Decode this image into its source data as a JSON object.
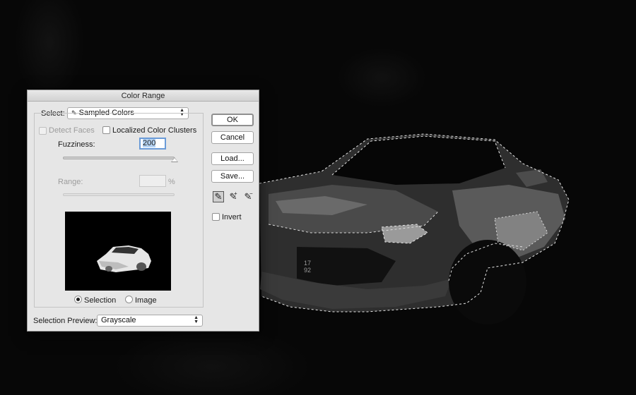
{
  "dialog": {
    "title": "Color Range",
    "select_label": "Select:",
    "select_value": "Sampled Colors",
    "detect_faces_label": "Detect Faces",
    "localized_label": "Localized Color Clusters",
    "fuzziness_label": "Fuzziness:",
    "fuzziness_value": "200",
    "fuzziness_level": 1.0,
    "range_label": "Range:",
    "range_unit": "%",
    "preview_mode_selection": "Selection",
    "preview_mode_image": "Image",
    "preview_mode_selected": "Selection",
    "selection_preview_label": "Selection Preview:",
    "selection_preview_value": "Grayscale"
  },
  "buttons": {
    "ok": "OK",
    "cancel": "Cancel",
    "load": "Load...",
    "save": "Save..."
  },
  "tools": {
    "eyedropper_icon": "eyedropper-icon",
    "add_icon": "eyedropper-plus-icon",
    "subtract_icon": "eyedropper-minus-icon",
    "active_tool": "eyedropper"
  },
  "invert_label": "Invert",
  "plate": {
    "line1": "17",
    "line2": "92"
  }
}
